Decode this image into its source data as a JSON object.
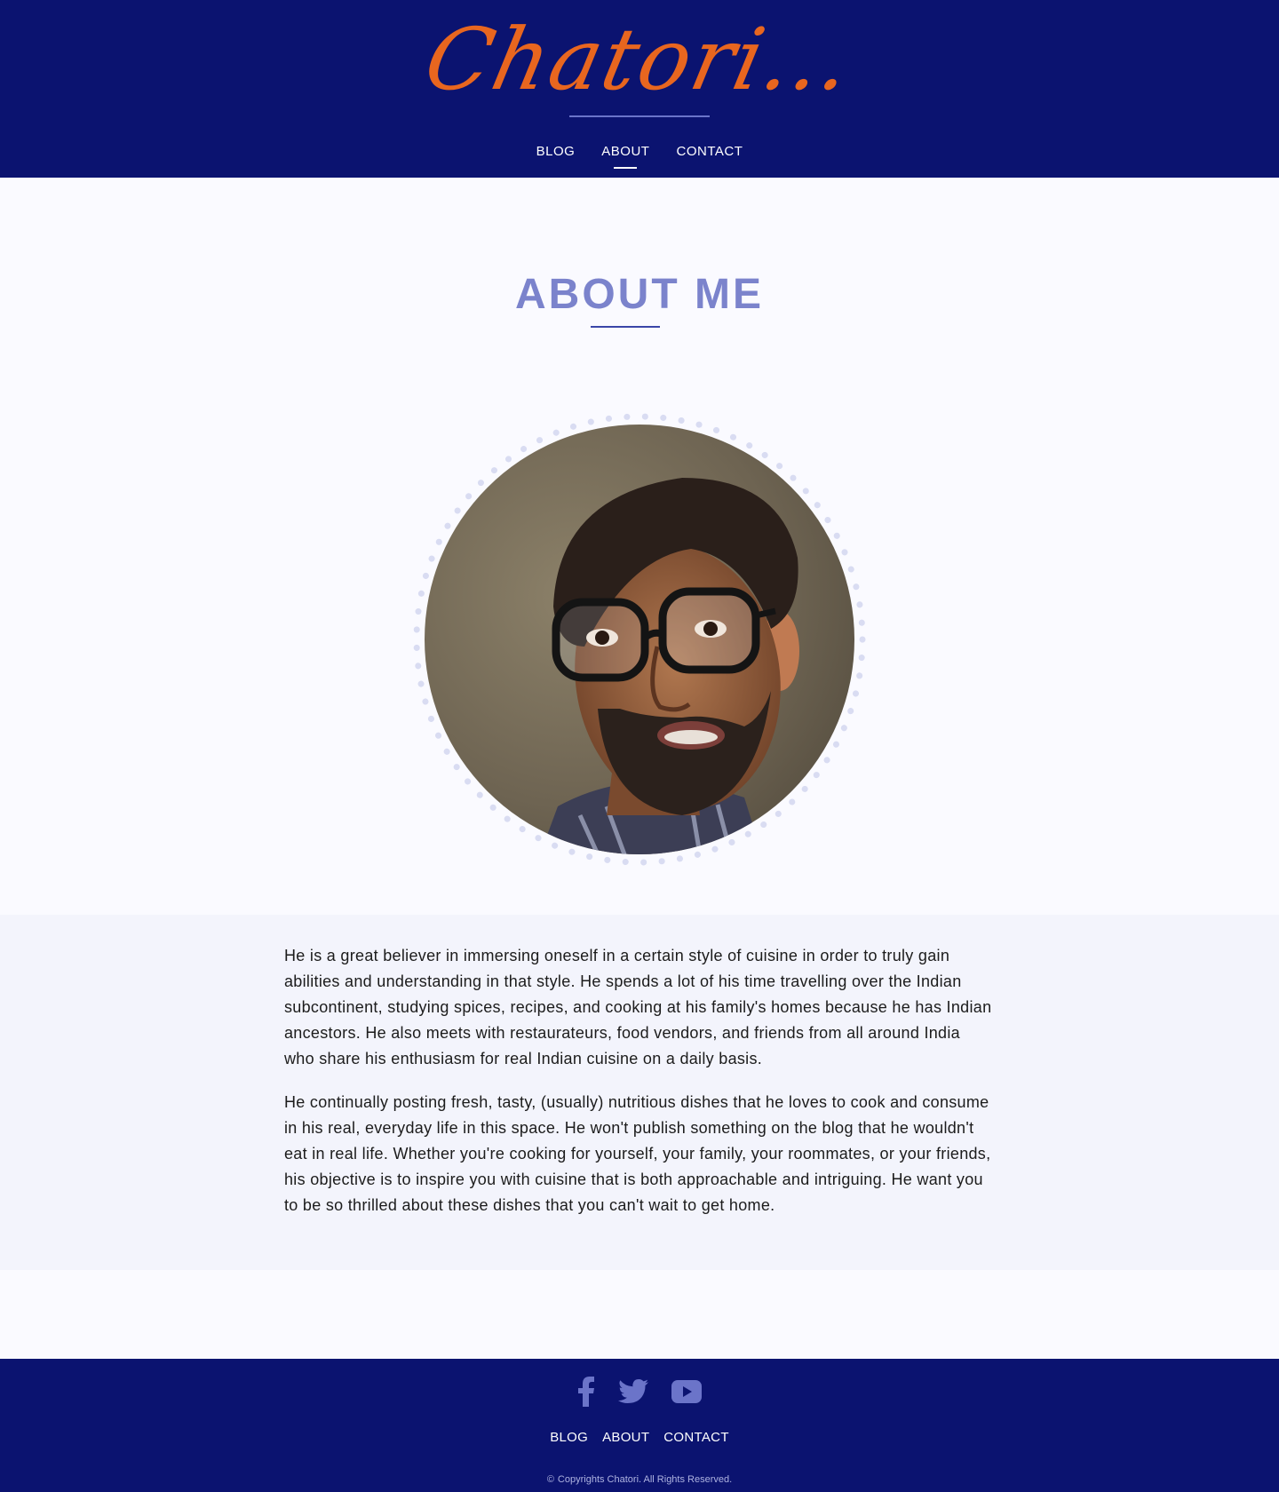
{
  "brand": {
    "logo_text": "Chatori...",
    "logo_color": "#e8661f"
  },
  "nav": {
    "items": [
      {
        "label": "BLOG",
        "active": false
      },
      {
        "label": "ABOUT",
        "active": true
      },
      {
        "label": "CONTACT",
        "active": false
      }
    ]
  },
  "page": {
    "title": "ABOUT ME"
  },
  "portrait": {
    "icon": "portrait-photo"
  },
  "about": {
    "paragraphs": [
      "He is a great believer in immersing oneself in a certain style of cuisine in order to truly gain abilities and understanding in that style. He spends a lot of his time travelling over the Indian subcontinent, studying spices, recipes, and cooking at his family's homes because he has Indian ancestors. He also meets with restaurateurs, food vendors, and friends from all around India who share his enthusiasm for real Indian cuisine on a daily basis.",
      "He continually posting fresh, tasty, (usually) nutritious dishes that he loves to cook and consume in his real, everyday life in this space. He won't publish something on the blog that he wouldn't eat in real life. Whether you're cooking for yourself, your family, your roommates, or your friends, his objective is to inspire you with cuisine that is both approachable and intriguing. He want you to be so thrilled about these dishes that you can't wait to get home."
    ]
  },
  "footer": {
    "social": [
      "facebook-icon",
      "twitter-icon",
      "youtube-icon"
    ],
    "links": [
      "BLOG",
      "ABOUT",
      "CONTACT"
    ],
    "copyright": "Copyrights Chatori. All Rights Reserved."
  },
  "colors": {
    "header_bg": "#0b1370",
    "accent_orange": "#e8661f",
    "title_purple": "#7b83cc",
    "rule_blue": "#3b46a8",
    "band_bg": "#f3f4fc",
    "page_bg": "#fafaff",
    "social_icon": "#6b74c9"
  }
}
